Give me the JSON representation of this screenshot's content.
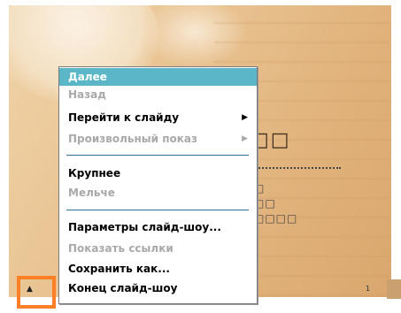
{
  "menu": {
    "items": [
      {
        "label": "Далее",
        "state": "selected"
      },
      {
        "label": "Назад",
        "state": "disabled"
      },
      {
        "label": "Перейти к слайду",
        "state": "enabled",
        "submenu": true
      },
      {
        "label": "Произвольный показ",
        "state": "disabled",
        "submenu": true
      },
      {
        "label": "Крупнее",
        "state": "enabled"
      },
      {
        "label": "Мельче",
        "state": "disabled"
      },
      {
        "label": "Параметры слайд-шоу...",
        "state": "enabled"
      },
      {
        "label": "Показать ссылки",
        "state": "disabled"
      },
      {
        "label": "Сохранить как...",
        "state": "enabled"
      },
      {
        "label": "Конец слайд-шоу",
        "state": "enabled"
      }
    ],
    "submenu_arrow": "▶"
  },
  "slide": {
    "shapes_big": "□□",
    "shapes_row1": "□",
    "shapes_row2": "□□",
    "shapes_row3": "□□□□",
    "page_number": "1"
  },
  "trigger": {
    "icon": "up-arrow-icon",
    "symbol": "▲"
  },
  "colors": {
    "selection": "#5bb7c8",
    "highlight_box": "#ff7f27",
    "separator": "#2e6f8e"
  }
}
